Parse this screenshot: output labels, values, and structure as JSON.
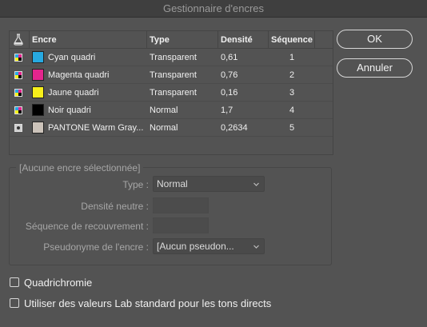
{
  "window": {
    "title": "Gestionnaire d'encres"
  },
  "table": {
    "headers": {
      "ink": "Encre",
      "type": "Type",
      "density": "Densité",
      "sequence": "Séquence"
    },
    "rows": [
      {
        "icon": "process-ink-icon",
        "swatch": "#27a9e1",
        "name": "Cyan quadri",
        "type": "Transparent",
        "density": "0,61",
        "sequence": "1"
      },
      {
        "icon": "process-ink-icon",
        "swatch": "#e4258d",
        "name": "Magenta quadri",
        "type": "Transparent",
        "density": "0,76",
        "sequence": "2"
      },
      {
        "icon": "process-ink-icon",
        "swatch": "#f7ef1a",
        "name": "Jaune quadri",
        "type": "Transparent",
        "density": "0,16",
        "sequence": "3"
      },
      {
        "icon": "process-ink-icon",
        "swatch": "#000000",
        "name": "Noir quadri",
        "type": "Normal",
        "density": "1,7",
        "sequence": "4"
      },
      {
        "icon": "spot-ink-icon",
        "swatch": "#ccc3ba",
        "name": "PANTONE Warm Gray...",
        "type": "Normal",
        "density": "0,2634",
        "sequence": "5"
      }
    ]
  },
  "buttons": {
    "ok": "OK",
    "cancel": "Annuler"
  },
  "group": {
    "title": "[Aucune encre sélectionnée]",
    "type_label": "Type :",
    "type_value": "Normal",
    "neutral_density_label": "Densité neutre :",
    "trap_sequence_label": "Séquence de recouvrement :",
    "alias_label": "Pseudonyme de l'encre :",
    "alias_value": "[Aucun pseudon..."
  },
  "options": {
    "process": "Quadrichromie",
    "lab": "Utiliser des valeurs Lab standard pour les tons directs"
  }
}
